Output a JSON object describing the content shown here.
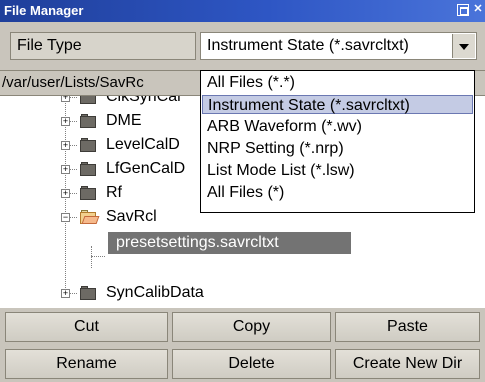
{
  "window": {
    "title": "File Manager"
  },
  "file_type": {
    "label": "File Type",
    "selected": "Instrument State (*.savrcltxt)",
    "options": [
      "All Files (*.*)",
      "Instrument State (*.savrcltxt)",
      "ARB Waveform (*.wv)",
      "NRP Setting (*.nrp)",
      "List Mode List (*.lsw)",
      "All Files (*)"
    ],
    "active_index": 1
  },
  "path": {
    "text": "/var/user/Lists/SavRc"
  },
  "tree": {
    "items": [
      {
        "label": "ClkSynCal"
      },
      {
        "label": "DME"
      },
      {
        "label": "LevelCalD"
      },
      {
        "label": "LfGenCalD"
      },
      {
        "label": "Rf"
      },
      {
        "label": "SavRcl"
      },
      {
        "label": "presetsettings.savrcltxt"
      },
      {
        "label": "SynCalibData"
      }
    ]
  },
  "buttons": {
    "cut": "Cut",
    "copy": "Copy",
    "paste": "Paste",
    "rename": "Rename",
    "delete": "Delete",
    "create_new_dir": "Create New Dir"
  },
  "colors": {
    "title_bar": "#2e56c4",
    "selection": "#737373",
    "dropdown_highlight": "#c4cbe4"
  }
}
